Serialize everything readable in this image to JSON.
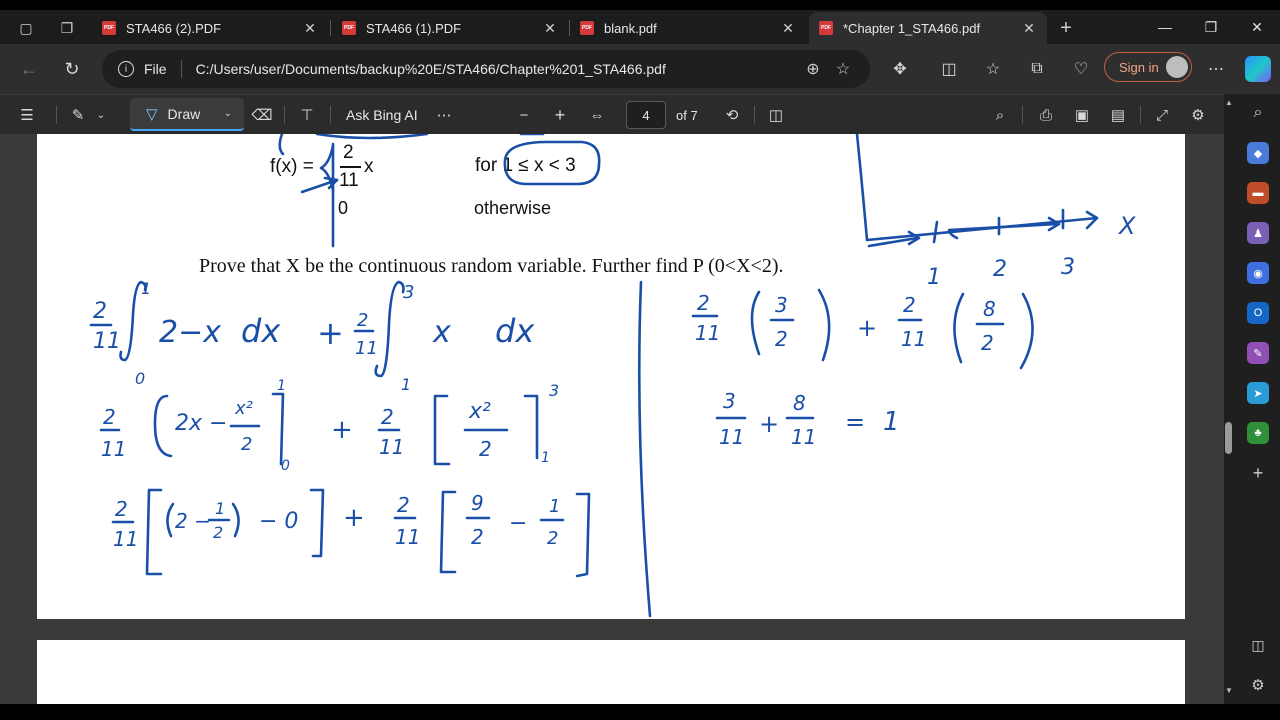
{
  "tabs": [
    {
      "title": "STA466 (2).PDF",
      "active": false
    },
    {
      "title": "STA466 (1).PDF",
      "active": false
    },
    {
      "title": "blank.pdf",
      "active": false
    },
    {
      "title": "*Chapter 1_STA466.pdf",
      "active": true
    }
  ],
  "address": {
    "file_label": "File",
    "url": "C:/Users/user/Documents/backup%20E/STA466/Chapter%201_STA466.pdf"
  },
  "account": {
    "signin_label": "Sign in"
  },
  "pdf_toolbar": {
    "draw_label": "Draw",
    "ask_label": "Ask Bing AI",
    "page_current": "4",
    "page_total": "of 7"
  },
  "document": {
    "func_lhs": "f(x) =",
    "frac_num": "2",
    "frac_den": "11",
    "frac_var": "x",
    "cond_1": "for 1 ≤ x < 3",
    "case2_value": "0",
    "case2_cond": "otherwise",
    "question": "Prove that X be the continuous random variable. Further find P (0<X<2)."
  },
  "colors": {
    "ink": "#1a4fa8",
    "accent": "#4aa8ff",
    "signin": "#c0623f"
  }
}
